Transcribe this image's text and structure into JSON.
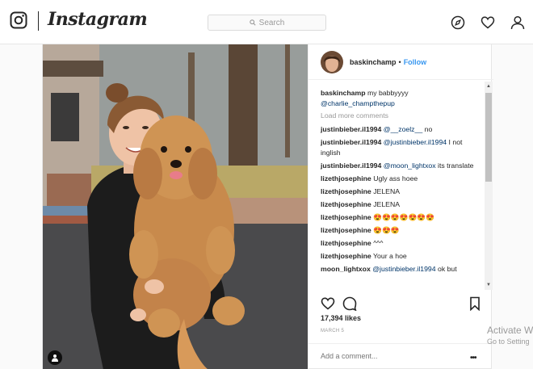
{
  "app": {
    "brand": "Instagram",
    "search_placeholder": "Search"
  },
  "nav_icons": [
    "instagram-logo-icon",
    "compass-icon",
    "heart-icon",
    "profile-icon"
  ],
  "post": {
    "username": "baskinchamp",
    "separator": "•",
    "follow_label": "Follow",
    "caption": {
      "user": "baskinchamp",
      "text": "my babbyyyy",
      "mention": "@charlie_champthepup"
    },
    "load_more": "Load more comments",
    "comments": [
      {
        "user": "justinbieber.il1994",
        "mention": "@__zoelz__",
        "text": "no"
      },
      {
        "user": "justinbieber.il1994",
        "mention": "@justinbieber.il1994",
        "text": "I not inglish"
      },
      {
        "user": "justinbieber.il1994",
        "mention": "@moon_lightxox",
        "text": "its translate"
      },
      {
        "user": "lizethjosephine",
        "mention": "",
        "text": "Ugly ass hoee"
      },
      {
        "user": "lizethjosephine",
        "mention": "",
        "text": "JELENA"
      },
      {
        "user": "lizethjosephine",
        "mention": "",
        "text": "JELENA"
      },
      {
        "user": "lizethjosephine",
        "mention": "",
        "text": "😍😍😍😍😍😍😍"
      },
      {
        "user": "lizethjosephine",
        "mention": "",
        "text": "😍😍😍"
      },
      {
        "user": "lizethjosephine",
        "mention": "",
        "text": "^^^"
      },
      {
        "user": "lizethjosephine",
        "mention": "",
        "text": "Your a hoe"
      },
      {
        "user": "moon_lightxox",
        "mention": "@justinbieber.il1994",
        "text": "ok but"
      }
    ],
    "likes": "17,394 likes",
    "date": "MARCH 5",
    "add_comment_placeholder": "Add a comment...",
    "more_label": "•••"
  },
  "watermark": {
    "line1": "Activate W",
    "line2": "Go to Setting"
  },
  "colors": {
    "link": "#3897f0",
    "mention": "#003569",
    "muted": "#999999",
    "text": "#262626"
  }
}
